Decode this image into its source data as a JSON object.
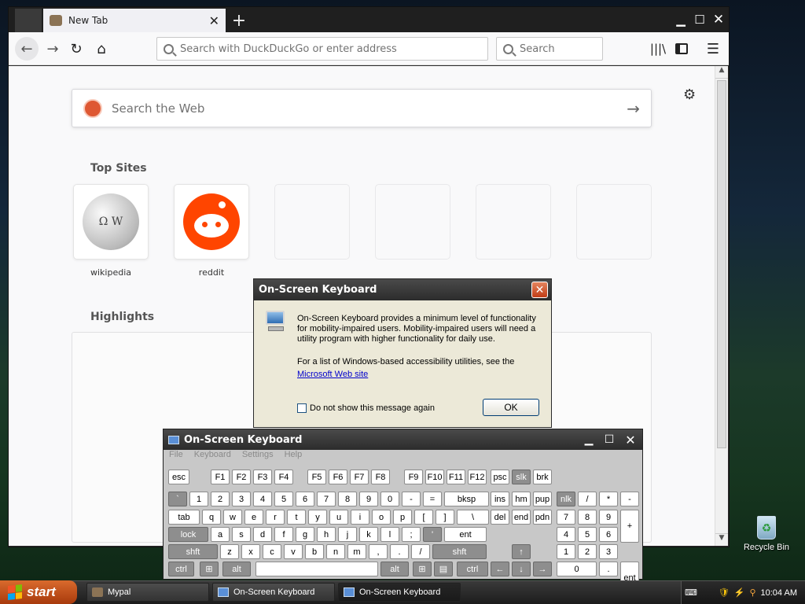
{
  "browser": {
    "tab_title": "New Tab",
    "url_placeholder": "Search with DuckDuckGo or enter address",
    "search_placeholder": "Search",
    "web_search_placeholder": "Search the Web",
    "top_sites_title": "Top Sites",
    "top_sites": [
      {
        "label": "wikipedia"
      },
      {
        "label": "reddit"
      }
    ],
    "highlights_title": "Highlights"
  },
  "dialog": {
    "title": "On-Screen Keyboard",
    "text1": "On-Screen Keyboard provides a minimum level of functionality for mobility-impaired users. Mobility-impaired users will need a utility program with higher functionality for daily use.",
    "text2": "For a list of Windows-based accessibility utilities, see the",
    "link": "Microsoft Web site",
    "checkbox_label": "Do not show this message again",
    "ok_label": "OK"
  },
  "osk": {
    "title": "On-Screen Keyboard",
    "menu": [
      "File",
      "Keyboard",
      "Settings",
      "Help"
    ]
  },
  "desktop": {
    "recycle_bin_label": "Recycle Bin"
  },
  "taskbar": {
    "start_label": "start",
    "tasks": [
      "Mypal",
      "On-Screen Keyboard",
      "On-Screen Keyboard"
    ],
    "clock": "10:04 AM"
  }
}
